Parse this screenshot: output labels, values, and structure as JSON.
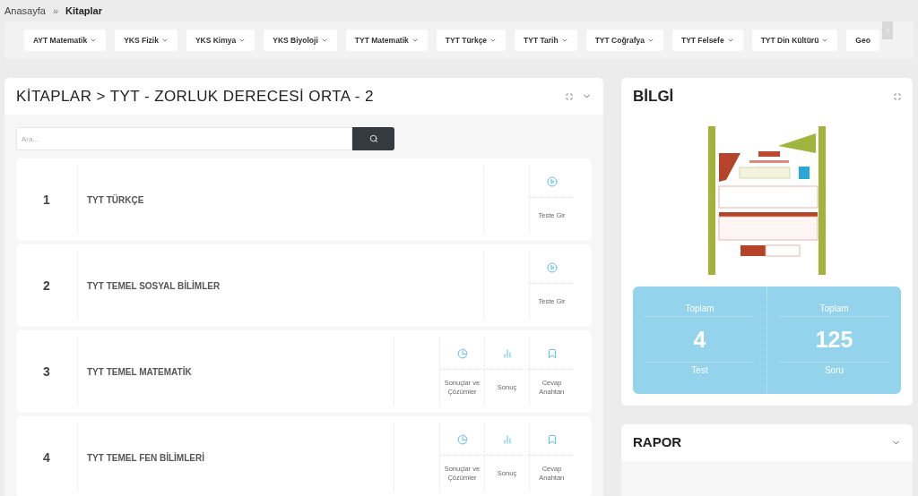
{
  "breadcrumb": [
    {
      "label": "Anasayfa",
      "current": false
    },
    {
      "label": "Kitaplar",
      "current": true
    }
  ],
  "breadcrumb_separator": "»",
  "categories": [
    "AYT Matematik",
    "YKS Fizik",
    "YKS Kimya",
    "YKS Biyoloji",
    "TYT Matematik",
    "TYT Türkçe",
    "TYT Tarih",
    "TYT Coğrafya",
    "TYT Felsefe",
    "TYT Din Kültürü",
    "Geo"
  ],
  "books_card": {
    "title": "KİTAPLAR > TYT - ZORLUK DERECESİ ORTA - 2",
    "search": {
      "placeholder": "Ara..."
    },
    "rows": [
      {
        "number": "1",
        "title": "TYT TÜRKÇE",
        "actions": [
          {
            "kind": "play",
            "label": "Teste Gir"
          }
        ]
      },
      {
        "number": "2",
        "title": "TYT TEMEL SOSYAL BİLİMLER",
        "actions": [
          {
            "kind": "play",
            "label": "Teste Gir"
          }
        ]
      },
      {
        "number": "3",
        "title": "TYT TEMEL MATEMATİK",
        "actions": [
          {
            "kind": "pie",
            "label": "Sonuçlar ve Çözümler"
          },
          {
            "kind": "bars",
            "label": "Sonuç"
          },
          {
            "kind": "bookmark",
            "label": "Cevap Anahtarı"
          }
        ]
      },
      {
        "number": "4",
        "title": "TYT TEMEL FEN BİLİMLERİ",
        "actions": [
          {
            "kind": "pie",
            "label": "Sonuçlar ve Çözümler"
          },
          {
            "kind": "bars",
            "label": "Sonuç"
          },
          {
            "kind": "bookmark",
            "label": "Cevap Anahtarı"
          }
        ]
      }
    ]
  },
  "info_card": {
    "title": "BİLGİ",
    "stats": [
      {
        "top": "Toplam",
        "value": "4",
        "bottom": "Test"
      },
      {
        "top": "Toplam",
        "value": "125",
        "bottom": "Soru"
      }
    ]
  },
  "report_card": {
    "title": "RAPOR"
  }
}
